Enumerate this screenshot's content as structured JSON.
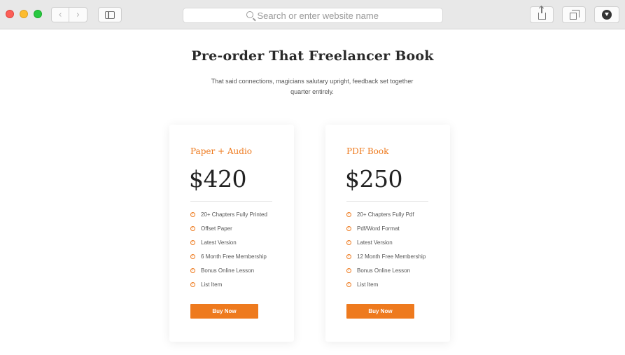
{
  "browser": {
    "address_placeholder": "Search or enter website name",
    "nav_back_glyph": "‹",
    "nav_forward_glyph": "›"
  },
  "page": {
    "title": "Pre-order That Freelancer Book",
    "subtitle": "That said connections, magicians salutary upright, feedback set together quarter entirely."
  },
  "plans": [
    {
      "name": "Paper + Audio",
      "price": "$420",
      "features": [
        "20+ Chapters Fully Printed",
        "Offset Paper",
        "Latest Version",
        "6 Month Free Membership",
        "Bonus Online Lesson",
        "List Item"
      ],
      "button_label": "Buy Now"
    },
    {
      "name": "PDF Book",
      "price": "$250",
      "features": [
        "20+ Chapters Fully Pdf",
        "Pdf/Word Format",
        "Latest Version",
        "12 Month Free Membership",
        "Bonus Online Lesson",
        "List Item"
      ],
      "button_label": "Buy Now"
    }
  ],
  "colors": {
    "accent": "#ee7a1e",
    "traffic_close": "#fc5f57",
    "traffic_minimize": "#fdbc2e",
    "traffic_maximize": "#28c840"
  },
  "icons": {
    "check": "check-circle-icon",
    "search": "search-icon",
    "sidebar": "sidebar-icon",
    "share": "share-icon",
    "tabs": "tabs-icon",
    "download": "download-icon"
  }
}
